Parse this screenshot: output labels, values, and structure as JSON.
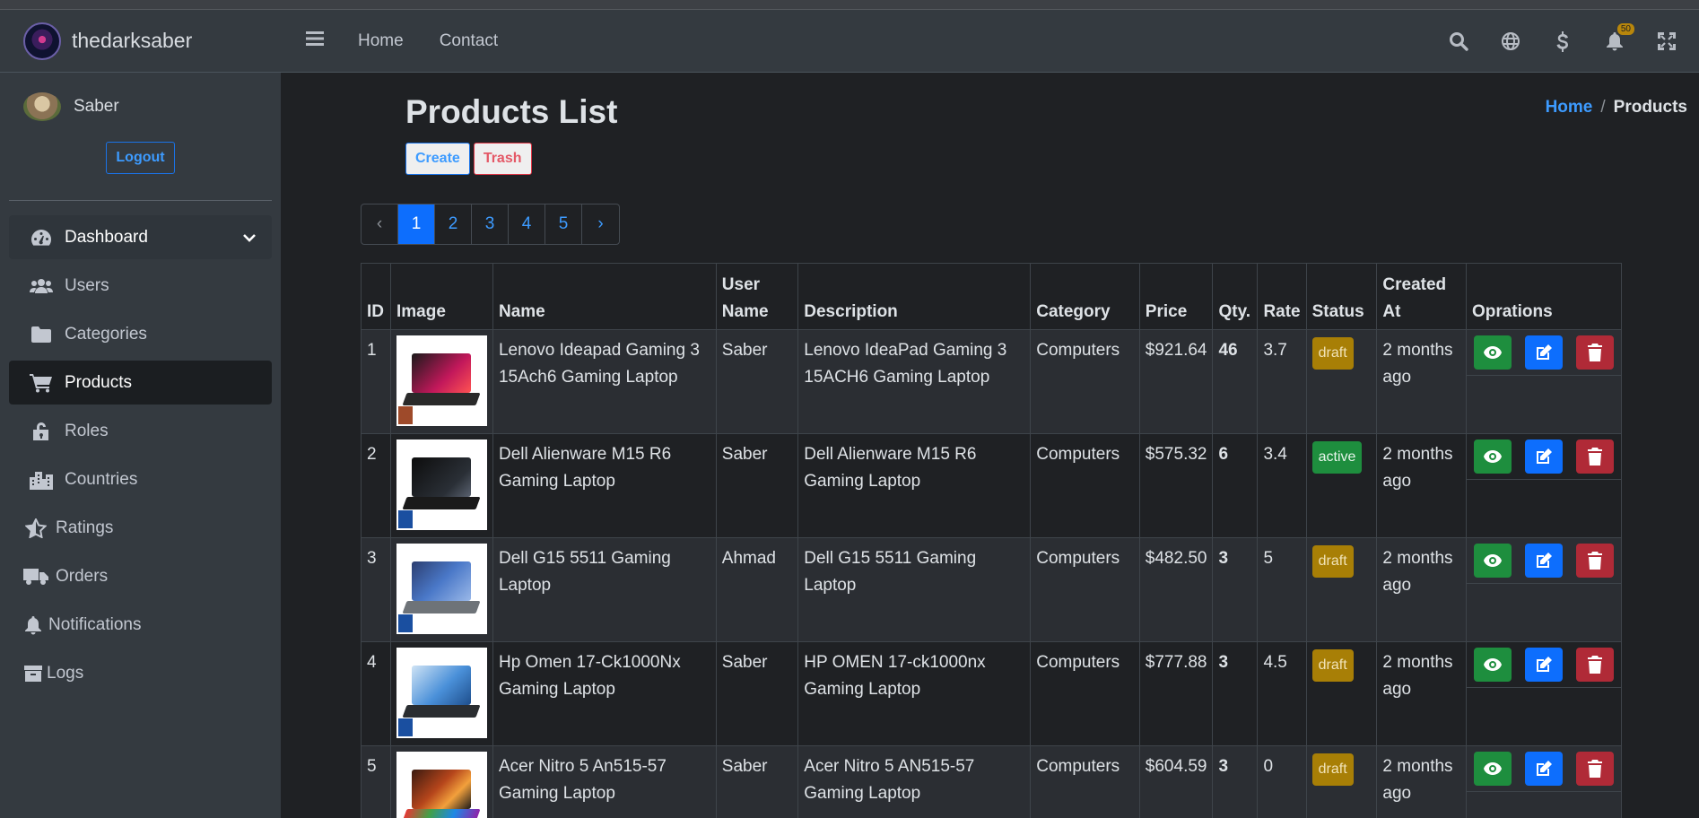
{
  "brand": {
    "name": "thedarksaber"
  },
  "user": {
    "name": "Saber",
    "logout_label": "Logout"
  },
  "sidebar": {
    "items": [
      {
        "label": "Dashboard",
        "icon": "gauge-icon"
      },
      {
        "label": "Users",
        "icon": "users-icon"
      },
      {
        "label": "Categories",
        "icon": "folder-icon"
      },
      {
        "label": "Products",
        "icon": "cart-icon"
      },
      {
        "label": "Roles",
        "icon": "unlock-icon"
      },
      {
        "label": "Countries",
        "icon": "city-icon"
      },
      {
        "label": "Ratings",
        "icon": "star-icon"
      },
      {
        "label": "Orders",
        "icon": "truck-icon"
      },
      {
        "label": "Notifications",
        "icon": "bell-icon"
      },
      {
        "label": "Logs",
        "icon": "archive-icon"
      }
    ]
  },
  "header": {
    "nav": [
      {
        "label": "Home"
      },
      {
        "label": "Contact"
      }
    ],
    "notification_count": "50"
  },
  "page": {
    "title": "Products List",
    "breadcrumb": {
      "home": "Home",
      "sep": "/",
      "current": "Products"
    },
    "create_label": "Create",
    "trash_label": "Trash"
  },
  "pagination": {
    "prev": "‹",
    "next": "›",
    "pages": [
      "1",
      "2",
      "3",
      "4",
      "5"
    ],
    "active": "1"
  },
  "table": {
    "headers": [
      "ID",
      "Image",
      "Name",
      "User Name",
      "Description",
      "Category",
      "Price",
      "Qty.",
      "Rate",
      "Status",
      "Created At",
      "Oprations"
    ],
    "rows": [
      {
        "id": "1",
        "name": "Lenovo Ideapad Gaming 3 15Ach6 Gaming Laptop",
        "user": "Saber",
        "description": "Lenovo IdeaPad Gaming 3 15ACH6 Gaming Laptop",
        "category": "Computers",
        "price": "$921.64",
        "qty": "46",
        "rate": "3.7",
        "status": "draft",
        "created": "2 months ago"
      },
      {
        "id": "2",
        "name": "Dell Alienware M15 R6 Gaming Laptop",
        "user": "Saber",
        "description": "Dell Alienware M15 R6 Gaming Laptop",
        "category": "Computers",
        "price": "$575.32",
        "qty": "6",
        "rate": "3.4",
        "status": "active",
        "created": "2 months ago"
      },
      {
        "id": "3",
        "name": "Dell G15 5511 Gaming Laptop",
        "user": "Ahmad",
        "description": "Dell G15 5511 Gaming Laptop",
        "category": "Computers",
        "price": "$482.50",
        "qty": "3",
        "rate": "5",
        "status": "draft",
        "created": "2 months ago"
      },
      {
        "id": "4",
        "name": "Hp Omen 17-Ck1000Nx Gaming Laptop",
        "user": "Saber",
        "description": "HP OMEN 17-ck1000nx Gaming Laptop",
        "category": "Computers",
        "price": "$777.88",
        "qty": "3",
        "rate": "4.5",
        "status": "draft",
        "created": "2 months ago"
      },
      {
        "id": "5",
        "name": "Acer Nitro 5 An515-57 Gaming Laptop",
        "user": "Saber",
        "description": "Acer Nitro 5 AN515-57 Gaming Laptop",
        "category": "Computers",
        "price": "$604.59",
        "qty": "3",
        "rate": "0",
        "status": "draft",
        "created": "2 months ago"
      }
    ]
  },
  "colors": {
    "primary": "#0d6efd",
    "success": "#1e8e3e",
    "danger": "#b02a37",
    "warning": "#a87f06",
    "sidebar": "#343a40",
    "content": "#1f2124"
  }
}
